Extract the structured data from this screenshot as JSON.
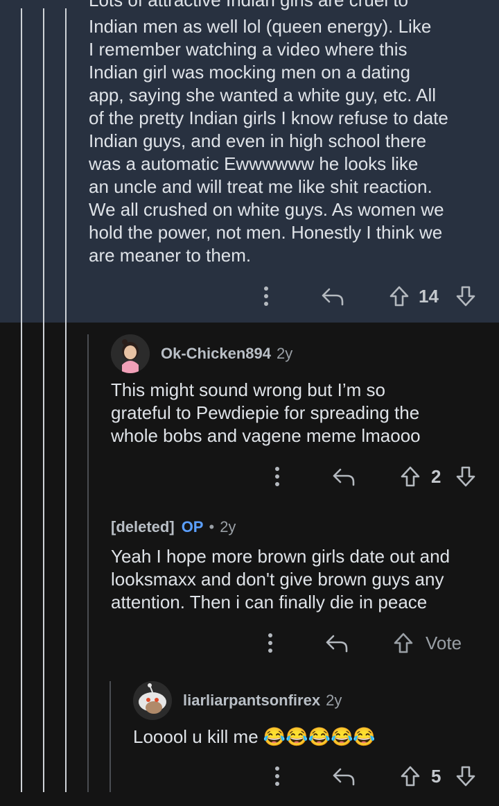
{
  "parent_comment": {
    "cutoff_line": "Lots of attractive Indian girls are cruel to",
    "lines": [
      "Indian men as well lol (queen energy). Like",
      "I remember watching a video where this",
      "Indian girl was mocking men on a dating",
      "app, saying she wanted a white guy, etc. All",
      "of the pretty Indian girls I know refuse to date",
      "Indian guys, and even in high school there",
      "was a automatic Ewwwwww he looks like",
      "an uncle and will treat me like shit reaction.",
      "We all crushed on white guys. As women we",
      "hold the power, not men. Honestly I think we",
      "are meaner to them."
    ],
    "score": "14"
  },
  "reply1": {
    "username": "Ok-Chicken894",
    "age": "2y",
    "lines": [
      "This might sound wrong but I’m so",
      "grateful to Pewdiepie for spreading the",
      "whole bobs and vagene meme lmaooo"
    ],
    "score": "2"
  },
  "reply2": {
    "username": "[deleted]",
    "op_badge": "OP",
    "separator": "•",
    "age": "2y",
    "lines": [
      "Yeah I hope more brown girls date out and",
      "looksmaxx and don't give brown guys any",
      "attention. Then i can finally die in peace"
    ],
    "vote_label": "Vote"
  },
  "reply3": {
    "username": "liarliarpantsonfirex",
    "age": "2y",
    "text": "Looool u kill me 😂😂😂😂😂",
    "score": "5"
  },
  "icons": [
    "more-options-icon",
    "reply-icon",
    "upvote-icon",
    "downvote-icon"
  ],
  "colors": {
    "highlight_bg": "#283140",
    "page_bg": "#141414",
    "op_blue": "#5b9fff"
  }
}
